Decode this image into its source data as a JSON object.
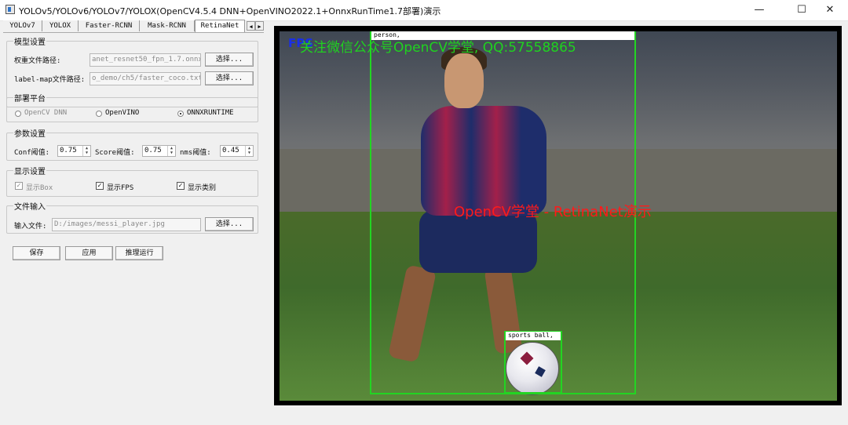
{
  "window": {
    "title": "YOLOv5/YOLOv6/YOLOv7/YOLOX(OpenCV4.5.4 DNN+OpenVINO2022.1+OnnxRunTime1.7部署)演示",
    "minimize": "—",
    "maximize": "☐",
    "close": "✕"
  },
  "tabs": [
    {
      "label": "YOLOv7"
    },
    {
      "label": "YOLOX"
    },
    {
      "label": "Faster-RCNN"
    },
    {
      "label": "Mask-RCNN"
    },
    {
      "label": "RetinaNet"
    }
  ],
  "model_settings": {
    "title": "模型设置",
    "weights_label": "权重文件路径:",
    "weights_value": "anet_resnet50_fpn_1.7.onnx",
    "labelmap_label": "label-map文件路径:",
    "labelmap_value": "o_demo/ch5/faster_coco.txt",
    "browse": "选择..."
  },
  "deploy": {
    "title": "部署平台",
    "options": [
      "OpenCV DNN",
      "OpenVINO",
      "ONNXRUNTIME"
    ],
    "selected": "ONNXRUNTIME"
  },
  "params": {
    "title": "参数设置",
    "conf_label": "Conf阈值:",
    "conf_value": "0.75",
    "score_label": "Score阈值:",
    "score_value": "0.75",
    "nms_label": "nms阈值:",
    "nms_value": "0.45"
  },
  "display": {
    "title": "显示设置",
    "show_box": "显示Box",
    "show_fps": "显示FPS",
    "show_class": "显示类别"
  },
  "file_input": {
    "title": "文件输入",
    "label": "输入文件:",
    "value": "D:/images/messi_player.jpg",
    "browse": "选择..."
  },
  "actions": {
    "save": "保存",
    "apply": "应用",
    "run": "推理运行"
  },
  "viewer": {
    "fps_text": "FPS",
    "watermark_text": "关注微信公众号OpenCV学堂, QQ:57558865",
    "demo_text": "OpenCV学堂 - RetinaNet演示",
    "detections": [
      {
        "label": "person,"
      },
      {
        "label": "sports ball,"
      }
    ]
  },
  "colors": {
    "box": "#22d522",
    "watermark": "#1fd31f",
    "demo_text": "#ff1a1a",
    "fps": "#1a2ee8"
  }
}
